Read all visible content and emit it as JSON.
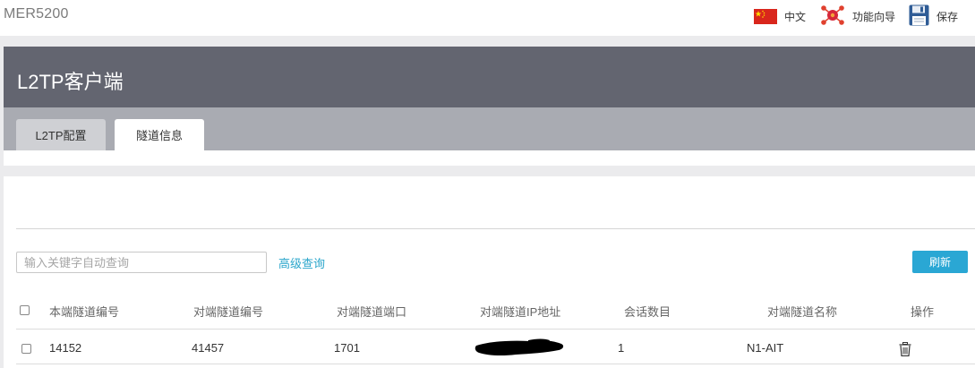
{
  "header": {
    "brand": "MER5200",
    "language_label": "中文",
    "wizard_label": "功能向导",
    "save_label": "保存",
    "language_icon": "china-flag-icon",
    "wizard_icon": "network-wizard-icon",
    "save_icon": "floppy-disk-icon"
  },
  "banner": {
    "title": "L2TP客户端"
  },
  "tabs": [
    {
      "label": "L2TP配置",
      "active": false
    },
    {
      "label": "隧道信息",
      "active": true
    }
  ],
  "toolbar": {
    "search_placeholder": "输入关键字自动查询",
    "search_value": "",
    "advanced_label": "高级查询",
    "refresh_label": "刷新"
  },
  "table": {
    "columns": [
      "本端隧道编号",
      "对端隧道编号",
      "对端隧道端口",
      "对端隧道IP地址",
      "会话数目",
      "对端隧道名称",
      "操作"
    ],
    "rows": [
      {
        "local_tunnel_id": "14152",
        "peer_tunnel_id": "41457",
        "peer_port": "1701",
        "peer_ip": "",
        "sessions": "1",
        "peer_name": "N1-AIT"
      }
    ]
  },
  "colors": {
    "banner": "#636570",
    "tabbar": "#a9abb2",
    "accent": "#2aa7d4",
    "link": "#2ba6cb"
  }
}
